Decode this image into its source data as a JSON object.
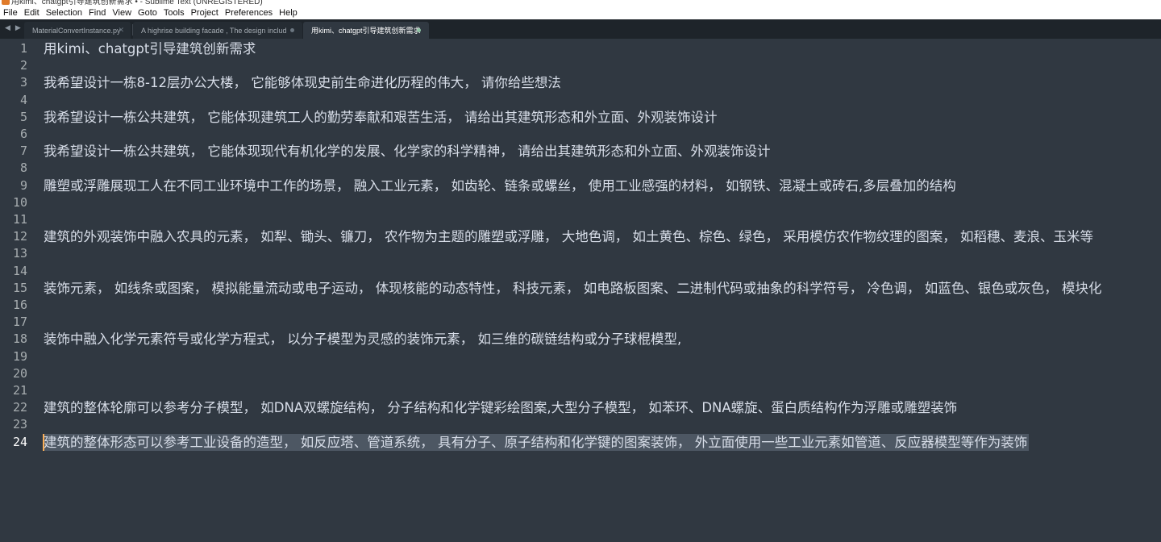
{
  "window": {
    "title": "用kimi、chatgpt引导建筑创新需求 • - Sublime Text (UNREGISTERED)"
  },
  "menu": [
    "File",
    "Edit",
    "Selection",
    "Find",
    "View",
    "Goto",
    "Tools",
    "Project",
    "Preferences",
    "Help"
  ],
  "tabs": [
    {
      "title": "MaterialConvertInstance.py",
      "state": "close"
    },
    {
      "title": "A highrise building facade , The design includes l",
      "state": "dirty"
    },
    {
      "title": "用kimi、chatgpt引导建筑创新需求",
      "state": "dirty"
    }
  ],
  "editor": {
    "current_line": 24,
    "lines": [
      {
        "n": "1",
        "text": "用kimi、chatgpt引导建筑创新需求"
      },
      {
        "n": "2",
        "text": ""
      },
      {
        "n": "3",
        "text": "我希望设计一栋8-12层办公大楼， 它能够体现史前生命进化历程的伟大， 请你给些想法"
      },
      {
        "n": "4",
        "text": ""
      },
      {
        "n": "5",
        "text": "我希望设计一栋公共建筑， 它能体现建筑工人的勤劳奉献和艰苦生活， 请给出其建筑形态和外立面、外观装饰设计"
      },
      {
        "n": "6",
        "text": ""
      },
      {
        "n": "7",
        "text": "我希望设计一栋公共建筑， 它能体现现代有机化学的发展、化学家的科学精神， 请给出其建筑形态和外立面、外观装饰设计"
      },
      {
        "n": "8",
        "text": ""
      },
      {
        "n": "9",
        "text": "雕塑或浮雕展现工人在不同工业环境中工作的场景， 融入工业元素， 如齿轮、链条或螺丝， 使用工业感强的材料， 如钢铁、混凝土或砖石,多层叠加的结构"
      },
      {
        "n": "10",
        "text": ""
      },
      {
        "n": "11",
        "text": ""
      },
      {
        "n": "12",
        "text": "建筑的外观装饰中融入农具的元素， 如犁、锄头、镰刀， 农作物为主题的雕塑或浮雕， 大地色调， 如土黄色、棕色、绿色， 采用模仿农作物纹理的图案， 如稻穗、麦浪、玉米等"
      },
      {
        "n": "13",
        "text": ""
      },
      {
        "n": "14",
        "text": ""
      },
      {
        "n": "15",
        "text": "装饰元素， 如线条或图案， 模拟能量流动或电子运动， 体现核能的动态特性， 科技元素， 如电路板图案、二进制代码或抽象的科学符号， 冷色调， 如蓝色、银色或灰色， 模块化"
      },
      {
        "n": "16",
        "text": ""
      },
      {
        "n": "17",
        "text": ""
      },
      {
        "n": "18",
        "text": "装饰中融入化学元素符号或化学方程式， 以分子模型为灵感的装饰元素， 如三维的碳链结构或分子球棍模型,"
      },
      {
        "n": "19",
        "text": ""
      },
      {
        "n": "20",
        "text": ""
      },
      {
        "n": "21",
        "text": ""
      },
      {
        "n": "22",
        "text": "建筑的整体轮廓可以参考分子模型， 如DNA双螺旋结构， 分子结构和化学键彩绘图案,大型分子模型， 如苯环、DNA螺旋、蛋白质结构作为浮雕或雕塑装饰"
      },
      {
        "n": "23",
        "text": ""
      },
      {
        "n": "24",
        "text": "建筑的整体形态可以参考工业设备的造型， 如反应塔、管道系统， 具有分子、原子结构和化学键的图案装饰， 外立面使用一些工业元素如管道、反应器模型等作为装饰"
      }
    ]
  }
}
